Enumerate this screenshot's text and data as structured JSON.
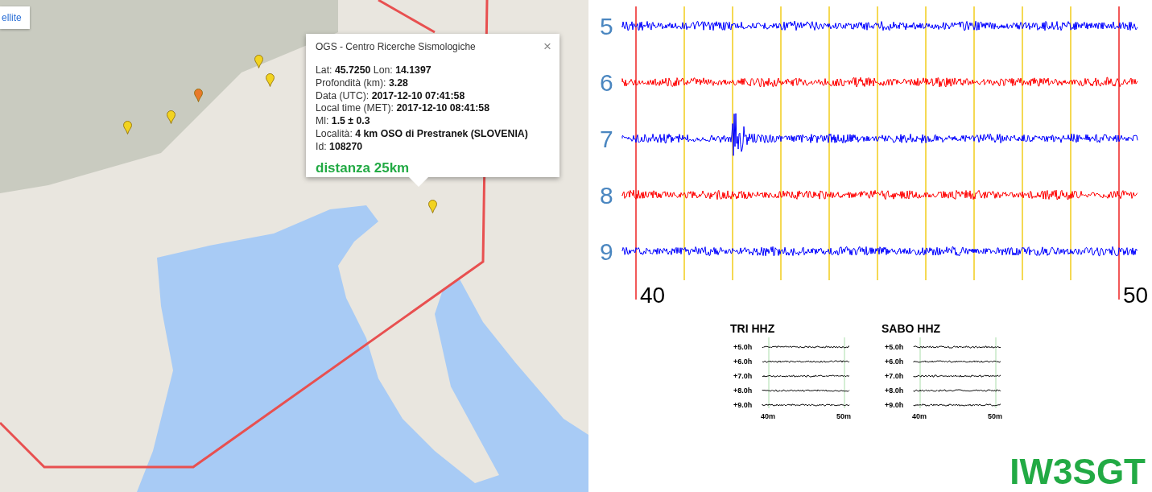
{
  "map": {
    "layer_button": "ellite",
    "markers": [
      {
        "color": "#f2d320"
      },
      {
        "color": "#f2d320"
      },
      {
        "color": "#e8792a"
      },
      {
        "color": "#f2d320"
      },
      {
        "color": "#f2d320"
      },
      {
        "color": "#f2d320"
      }
    ],
    "popup": {
      "title": "OGS - Centro Ricerche Sismologiche",
      "close": "×",
      "lines": [
        "Lat: **45.7250** Lon: **14.1397**",
        "Profondità (km): **3.28**",
        "Data (UTC): **2017-12-10 07:41:58**",
        "Local time (MET): **2017-12-10 08:41:58**",
        "Ml: **1.5 ± 0.3**",
        "Località: **4 km OSO di Prestranek (SLOVENIA)**",
        "Id: **108270**"
      ],
      "distance": "distanza 25km"
    }
  },
  "seismogram": {
    "traces": [
      {
        "label": "5",
        "color": "#0000ff"
      },
      {
        "label": "6",
        "color": "#ff0000"
      },
      {
        "label": "7",
        "color": "#0000ff"
      },
      {
        "label": "8",
        "color": "#ff0000"
      },
      {
        "label": "9",
        "color": "#0000ff"
      }
    ],
    "x_labels": [
      "40",
      "50"
    ]
  },
  "helicorders": [
    {
      "title": "TRI HHZ",
      "rows": [
        "+5.0h",
        "+6.0h",
        "+7.0h",
        "+8.0h",
        "+9.0h"
      ],
      "x_labels": [
        "40m",
        "50m"
      ]
    },
    {
      "title": "SABO HHZ",
      "rows": [
        "+5.0h",
        "+6.0h",
        "+7.0h",
        "+8.0h",
        "+9.0h"
      ],
      "x_labels": [
        "40m",
        "50m"
      ]
    }
  ],
  "callsign": "IW3SGT"
}
